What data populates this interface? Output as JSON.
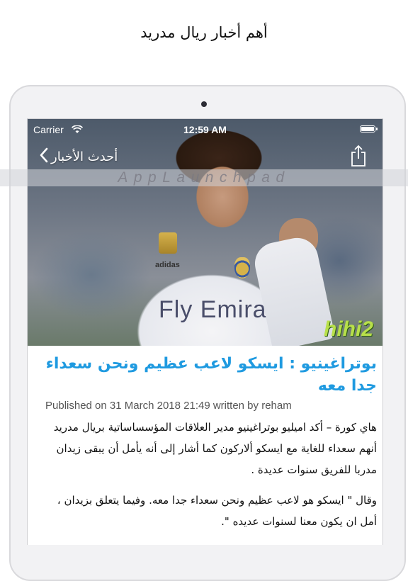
{
  "caption": "أهم أخبار ريال مدريد",
  "status_bar": {
    "carrier": "Carrier",
    "time": "12:59 AM"
  },
  "nav": {
    "back_label": "أحدث الأخبار"
  },
  "watermark": "AppLaunchpad",
  "article": {
    "title": "بوتراغينيو : ايسكو لاعب عظيم ونحن سعداء جدا معه",
    "meta": "Published on 31 March 2018 21:49 written by reham",
    "paragraphs": [
      "هاي كورة – أكد اميليو بوتراغينيو مدير العلاقات المؤسساساتية بريال مدريد أنهم سعداء للغاية مع ايسكو ألاركون كما أشار إلى أنه يأمل أن يبقى زيدان مدربا للفريق سنوات عديدة .",
      "وقال \" ايسكو هو لاعب عظيم ونحن سعداء جدا معه. وفيما يتعلق بزيدان ، أمل ان يكون معنا لسنوات عديده \"."
    ]
  },
  "image": {
    "shirt_sponsor": "Fly Emirates",
    "kit_brand": "adidas",
    "corner_logo": "hihi2"
  },
  "icons": {
    "back": "chevron-left-icon",
    "share": "share-icon",
    "wifi": "wifi-icon",
    "battery": "battery-icon"
  }
}
